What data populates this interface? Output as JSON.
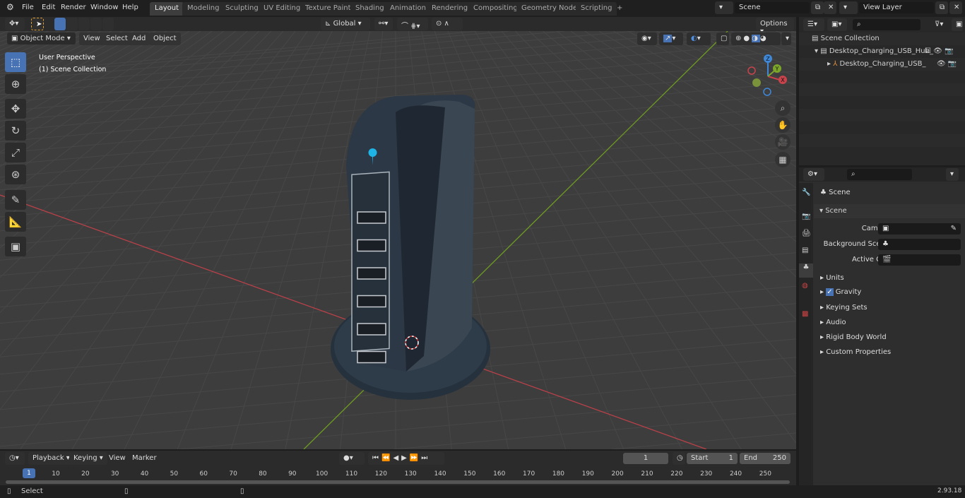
{
  "top_menu": [
    "File",
    "Edit",
    "Render",
    "Window",
    "Help"
  ],
  "workspaces": [
    "Layout",
    "Modeling",
    "Sculpting",
    "UV Editing",
    "Texture Paint",
    "Shading",
    "Animation",
    "Rendering",
    "Compositing",
    "Geometry Nodes",
    "Scripting"
  ],
  "active_workspace": "Layout",
  "scene_name": "Scene",
  "view_layer": "View Layer",
  "header": {
    "mode": "Object Mode",
    "menus": [
      "View",
      "Select",
      "Add",
      "Object"
    ],
    "transform_orientation": "Global",
    "options": "Options"
  },
  "viewport": {
    "perspective": "User Perspective",
    "collection": "(1) Scene Collection",
    "gizmo": {
      "x": "X",
      "y": "Y",
      "z": "Z"
    }
  },
  "toolbar": [
    "select-box",
    "cursor",
    "move",
    "rotate",
    "scale",
    "transform",
    "annotate",
    "measure",
    "add-cube"
  ],
  "outliner": {
    "root": "Scene Collection",
    "items": [
      {
        "name": "Desktop_Charging_USB_Hub_",
        "level": 1,
        "expanded": true
      },
      {
        "name": "Desktop_Charging_USB_",
        "level": 2,
        "expanded": false
      }
    ]
  },
  "properties": {
    "title": "Scene",
    "section": "Scene",
    "fields": [
      {
        "label": "Camera",
        "value": ""
      },
      {
        "label": "Background Scene",
        "value": ""
      },
      {
        "label": "Active Clip",
        "value": ""
      }
    ],
    "panels": [
      "Units",
      "Gravity",
      "Keying Sets",
      "Audio",
      "Rigid Body World",
      "Custom Properties"
    ],
    "gravity_checked": true
  },
  "timeline": {
    "menus": [
      "Playback",
      "Keying",
      "View",
      "Marker"
    ],
    "current_frame": "1",
    "start_label": "Start",
    "start": "1",
    "end_label": "End",
    "end": "250",
    "ticks": [
      "10",
      "20",
      "30",
      "40",
      "50",
      "60",
      "70",
      "80",
      "90",
      "100",
      "110",
      "120",
      "130",
      "140",
      "150",
      "160",
      "170",
      "180",
      "190",
      "200",
      "210",
      "220",
      "230",
      "240",
      "250"
    ]
  },
  "status": {
    "left": "Select",
    "version": "2.93.18"
  },
  "colors": {
    "accent": "#4772b3",
    "x_axis": "#c8434b",
    "y_axis": "#7ba62a",
    "z_axis": "#3f88d8",
    "led": "#1eb4e6"
  }
}
